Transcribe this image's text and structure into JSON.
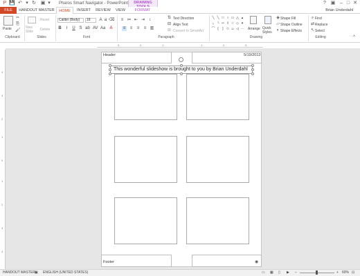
{
  "window": {
    "title": "Pharos Smart Navigator - PowerPoint",
    "contextual_tab_group": "DRAWING TOOLS",
    "user": "Brian Underdahl"
  },
  "tabs": [
    {
      "label": "FILE"
    },
    {
      "label": "HANDOUT MASTER"
    },
    {
      "label": "HOME"
    },
    {
      "label": "INSERT"
    },
    {
      "label": "REVIEW"
    },
    {
      "label": "VIEW"
    },
    {
      "label": "FORMAT"
    }
  ],
  "active_tab": "HOME",
  "ribbon": {
    "clipboard": {
      "label": "Clipboard",
      "paste": "Paste"
    },
    "slides": {
      "label": "Slides",
      "new_slide": "New Slide",
      "reset": "Reset",
      "delete": "Delete"
    },
    "font": {
      "label": "Font",
      "font_name": "Calibri (Body)",
      "font_size": "18"
    },
    "paragraph": {
      "label": "Paragraph",
      "text_direction": "Text Direction",
      "align_text": "Align Text",
      "convert_smartart": "Convert to SmartArt"
    },
    "drawing": {
      "label": "Drawing",
      "arrange": "Arrange",
      "quick_styles": "Quick Styles",
      "shape_fill": "Shape Fill",
      "shape_outline": "Shape Outline",
      "shape_effects": "Shape Effects"
    },
    "editing": {
      "label": "Editing",
      "find": "Find",
      "replace": "Replace",
      "select": "Select"
    }
  },
  "ruler": {
    "h_ticks": [
      "3",
      "2",
      "1",
      "1",
      "2",
      "3"
    ],
    "v_ticks": [
      "4",
      "3",
      "2",
      "1",
      "0",
      "1",
      "2",
      "3",
      "4"
    ]
  },
  "page": {
    "header": "Header",
    "date": "5/19/2013",
    "title_text": "This wonderful slideshow is brought to you by Brian Underdahl",
    "footer": "Footer"
  },
  "status": {
    "view": "HANDOUT MASTER",
    "language": "ENGLISH (UNITED STATES)",
    "zoom": "60%"
  },
  "colors": {
    "file_tab": "#d24726",
    "accent": "#d24726",
    "contextual": "#b24fd5"
  }
}
